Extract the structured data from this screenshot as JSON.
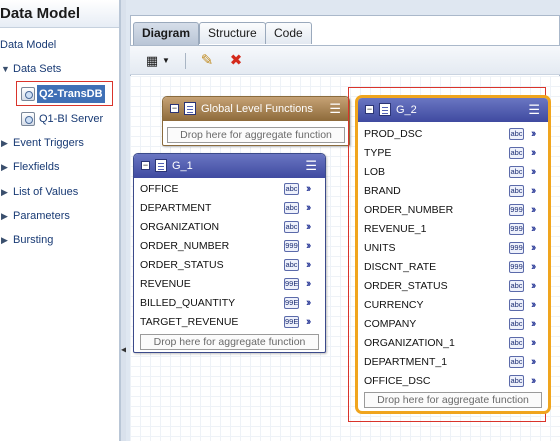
{
  "left_panel": {
    "title": "Data Model",
    "tree": [
      {
        "label": "Data Model"
      },
      {
        "label": "Data Sets",
        "children": [
          {
            "label": "Q2-TransDB",
            "selected": true
          },
          {
            "label": "Q1-BI Server",
            "selected": false
          }
        ]
      },
      {
        "label": "Event Triggers"
      },
      {
        "label": "Flexfields"
      },
      {
        "label": "List of Values"
      },
      {
        "label": "Parameters"
      },
      {
        "label": "Bursting"
      }
    ]
  },
  "tabs": [
    {
      "label": "Diagram",
      "active": true
    },
    {
      "label": "Structure",
      "active": false
    },
    {
      "label": "Code",
      "active": false
    }
  ],
  "toolbar": {
    "new_icon": "new-data-set-icon",
    "edit_icon": "pencil-icon",
    "delete_icon": "delete-x-icon"
  },
  "glf": {
    "title": "Global Level Functions",
    "dropzone": "Drop here for aggregate function"
  },
  "g1": {
    "title": "G_1",
    "fields": [
      {
        "name": "OFFICE",
        "type": "abc"
      },
      {
        "name": "DEPARTMENT",
        "type": "abc"
      },
      {
        "name": "ORGANIZATION",
        "type": "abc"
      },
      {
        "name": "ORDER_NUMBER",
        "type": "999"
      },
      {
        "name": "ORDER_STATUS",
        "type": "abc"
      },
      {
        "name": "REVENUE",
        "type": "99E"
      },
      {
        "name": "BILLED_QUANTITY",
        "type": "99E"
      },
      {
        "name": "TARGET_REVENUE",
        "type": "99E"
      }
    ],
    "dropzone": "Drop here for aggregate function"
  },
  "g2": {
    "title": "G_2",
    "fields": [
      {
        "name": "PROD_DSC",
        "type": "abc"
      },
      {
        "name": "TYPE",
        "type": "abc"
      },
      {
        "name": "LOB",
        "type": "abc"
      },
      {
        "name": "BRAND",
        "type": "abc"
      },
      {
        "name": "ORDER_NUMBER",
        "type": "999"
      },
      {
        "name": "REVENUE_1",
        "type": "999"
      },
      {
        "name": "UNITS",
        "type": "999"
      },
      {
        "name": "DISCNT_RATE",
        "type": "999"
      },
      {
        "name": "ORDER_STATUS",
        "type": "abc"
      },
      {
        "name": "CURRENCY",
        "type": "abc"
      },
      {
        "name": "COMPANY",
        "type": "abc"
      },
      {
        "name": "ORGANIZATION_1",
        "type": "abc"
      },
      {
        "name": "DEPARTMENT_1",
        "type": "abc"
      },
      {
        "name": "OFFICE_DSC",
        "type": "abc"
      }
    ],
    "dropzone": "Drop here for aggregate function"
  },
  "colors": {
    "group_header": "#4a55a8",
    "glf_header": "#a88453",
    "selected_group_border": "#f0a51e",
    "highlight_box": "#d9342b",
    "tree_selected": "#3f70b6"
  }
}
